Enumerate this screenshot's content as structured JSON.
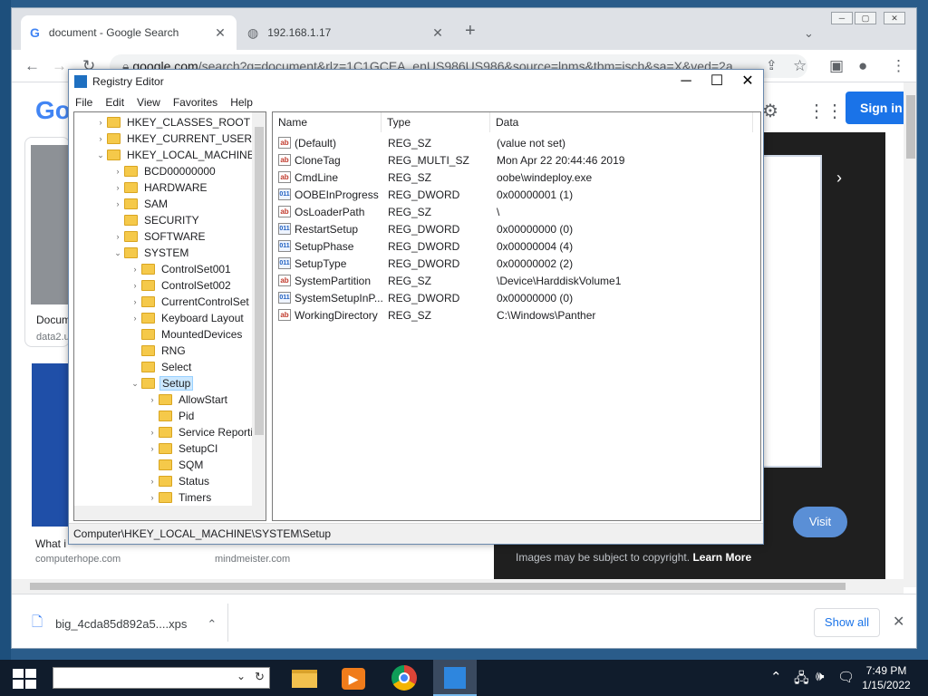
{
  "chrome": {
    "tabs": [
      {
        "title": "document - Google Search",
        "close": "✕"
      },
      {
        "title": "192.168.1.17",
        "close": "✕"
      }
    ],
    "new_tab": "+",
    "window_controls": [
      "─",
      "▢",
      "✕"
    ],
    "address_domain": "google.com",
    "address_rest": "/search?q=document&rlz=1C1GCEA_enUS986US986&source=lnms&tbm=isch&sa=X&ved=2a...",
    "page": {
      "logo": "Go",
      "signin": "Sign in",
      "result1_title": "Docum",
      "result1_source": "data2.u",
      "result2_title": "What i",
      "result2_source": "computerhope.com",
      "result3_source": "mindmeister.com",
      "panel_visit": "Visit",
      "panel_copyright": "Images may be subject to copyright.",
      "panel_learn_more": "Learn More"
    },
    "download": {
      "file": "big_4cda85d892a5....xps",
      "show_all": "Show all",
      "close": "✕"
    }
  },
  "regedit": {
    "title": "Registry Editor",
    "menu": [
      "File",
      "Edit",
      "View",
      "Favorites",
      "Help"
    ],
    "window_controls": [
      "─",
      "☐",
      "✕"
    ],
    "tree": [
      {
        "label": "HKEY_CLASSES_ROOT",
        "level": 0,
        "arrow": "›"
      },
      {
        "label": "HKEY_CURRENT_USER",
        "level": 0,
        "arrow": "›"
      },
      {
        "label": "HKEY_LOCAL_MACHINE",
        "level": 0,
        "arrow": "⌄"
      },
      {
        "label": "BCD00000000",
        "level": 1,
        "arrow": "›"
      },
      {
        "label": "HARDWARE",
        "level": 1,
        "arrow": "›"
      },
      {
        "label": "SAM",
        "level": 1,
        "arrow": "›"
      },
      {
        "label": "SECURITY",
        "level": 1,
        "arrow": ""
      },
      {
        "label": "SOFTWARE",
        "level": 1,
        "arrow": "›"
      },
      {
        "label": "SYSTEM",
        "level": 1,
        "arrow": "⌄"
      },
      {
        "label": "ControlSet001",
        "level": 2,
        "arrow": "›"
      },
      {
        "label": "ControlSet002",
        "level": 2,
        "arrow": "›"
      },
      {
        "label": "CurrentControlSet",
        "level": 2,
        "arrow": "›"
      },
      {
        "label": "Keyboard Layout",
        "level": 2,
        "arrow": "›"
      },
      {
        "label": "MountedDevices",
        "level": 2,
        "arrow": ""
      },
      {
        "label": "RNG",
        "level": 2,
        "arrow": ""
      },
      {
        "label": "Select",
        "level": 2,
        "arrow": ""
      },
      {
        "label": "Setup",
        "level": 2,
        "arrow": "⌄",
        "selected": true
      },
      {
        "label": "AllowStart",
        "level": 3,
        "arrow": "›"
      },
      {
        "label": "Pid",
        "level": 3,
        "arrow": ""
      },
      {
        "label": "Service Reporting",
        "level": 3,
        "arrow": "›"
      },
      {
        "label": "SetupCI",
        "level": 3,
        "arrow": "›"
      },
      {
        "label": "SQM",
        "level": 3,
        "arrow": ""
      },
      {
        "label": "Status",
        "level": 3,
        "arrow": "›"
      },
      {
        "label": "Timers",
        "level": 3,
        "arrow": "›"
      }
    ],
    "columns": [
      "Name",
      "Type",
      "Data"
    ],
    "values": [
      {
        "icon": "ab",
        "name": "(Default)",
        "type": "REG_SZ",
        "data": "(value not set)"
      },
      {
        "icon": "ab",
        "name": "CloneTag",
        "type": "REG_MULTI_SZ",
        "data": "Mon Apr 22 20:44:46 2019"
      },
      {
        "icon": "ab",
        "name": "CmdLine",
        "type": "REG_SZ",
        "data": "oobe\\windeploy.exe"
      },
      {
        "icon": "bin",
        "name": "OOBEInProgress",
        "type": "REG_DWORD",
        "data": "0x00000001 (1)"
      },
      {
        "icon": "ab",
        "name": "OsLoaderPath",
        "type": "REG_SZ",
        "data": "\\"
      },
      {
        "icon": "bin",
        "name": "RestartSetup",
        "type": "REG_DWORD",
        "data": "0x00000000 (0)"
      },
      {
        "icon": "bin",
        "name": "SetupPhase",
        "type": "REG_DWORD",
        "data": "0x00000004 (4)"
      },
      {
        "icon": "bin",
        "name": "SetupType",
        "type": "REG_DWORD",
        "data": "0x00000002 (2)"
      },
      {
        "icon": "ab",
        "name": "SystemPartition",
        "type": "REG_SZ",
        "data": "\\Device\\HarddiskVolume1"
      },
      {
        "icon": "bin",
        "name": "SystemSetupInP...",
        "type": "REG_DWORD",
        "data": "0x00000000 (0)"
      },
      {
        "icon": "ab",
        "name": "WorkingDirectory",
        "type": "REG_SZ",
        "data": "C:\\Windows\\Panther"
      }
    ],
    "status_path": "Computer\\HKEY_LOCAL_MACHINE\\SYSTEM\\Setup"
  },
  "taskbar": {
    "time": "7:49 PM",
    "date": "1/15/2022"
  },
  "colors": {
    "accent": "#1a73e8",
    "folder": "#f5c94a",
    "taskbar": "#101c2c"
  }
}
